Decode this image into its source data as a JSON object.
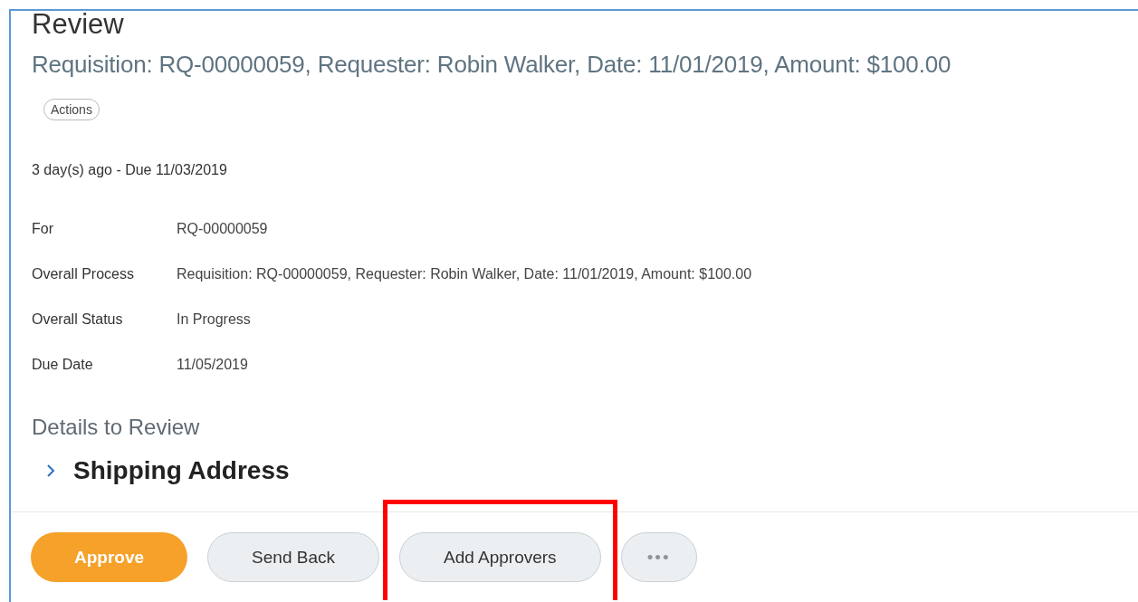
{
  "title": "Review",
  "subtitle": "Requisition: RQ-00000059, Requester: Robin Walker, Date: 11/01/2019, Amount: $100.00",
  "actions_label": "Actions",
  "due_info": "3 day(s) ago - Due 11/03/2019",
  "fields": [
    {
      "label": "For",
      "value": "RQ-00000059"
    },
    {
      "label": "Overall Process",
      "value": "Requisition: RQ-00000059, Requester: Robin Walker, Date: 11/01/2019, Amount: $100.00"
    },
    {
      "label": "Overall Status",
      "value": "In Progress"
    },
    {
      "label": "Due Date",
      "value": "11/05/2019"
    }
  ],
  "details_heading": "Details to Review",
  "sections": [
    {
      "title": "Shipping Address",
      "expanded": false
    }
  ],
  "buttons": [
    {
      "kind": "primary",
      "label": "Approve",
      "highlighted": false
    },
    {
      "kind": "secondary",
      "label": "Send Back",
      "highlighted": false
    },
    {
      "kind": "secondary",
      "label": "Add Approvers",
      "highlighted": true
    },
    {
      "kind": "more",
      "label": "•••",
      "highlighted": false
    }
  ]
}
